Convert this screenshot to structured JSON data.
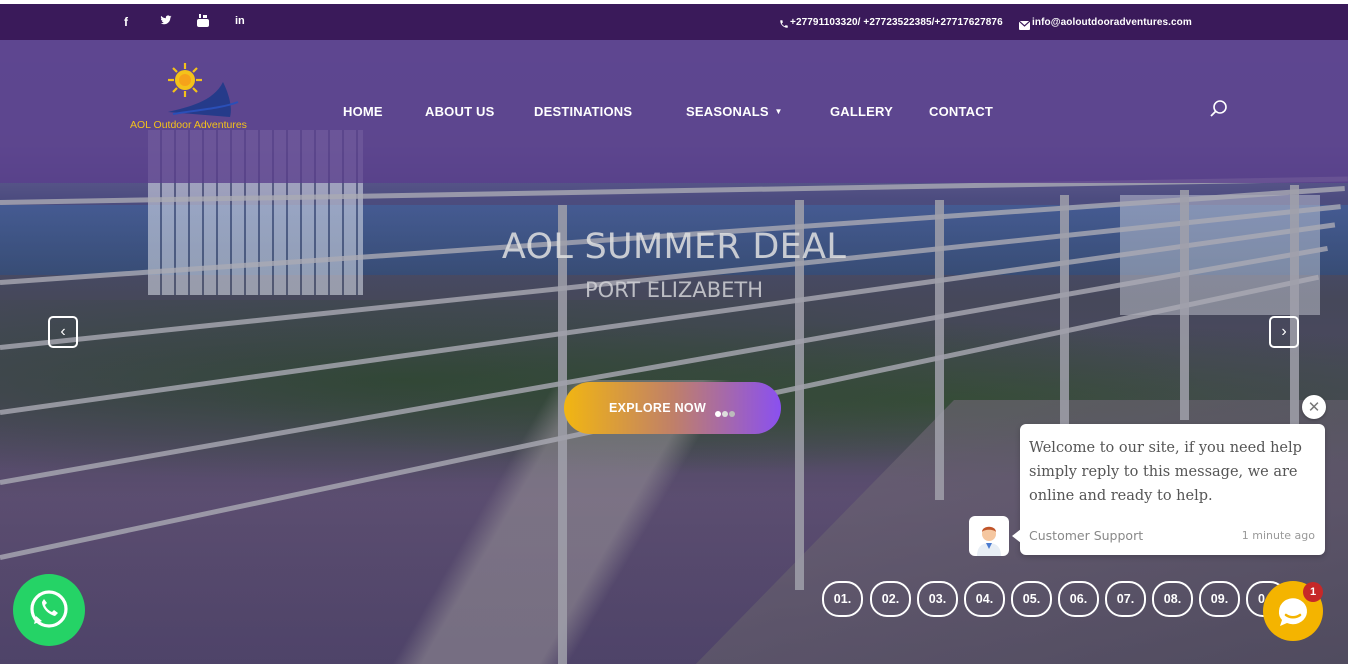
{
  "topbar": {
    "social": [
      {
        "icon": "facebook-icon",
        "glyph": "f"
      },
      {
        "icon": "twitter-icon",
        "glyph": "🐦"
      },
      {
        "icon": "youtube-icon",
        "glyph": "▶"
      },
      {
        "icon": "linkedin-icon",
        "glyph": "in"
      }
    ],
    "phone_icon": "phone-icon",
    "phone": "+27791103320/ +27723522385/+27717627876",
    "email_icon": "envelope-icon",
    "email": "info@aoloutdooradventures.com",
    "bg_color": "#3a1a5a"
  },
  "header": {
    "logo_text": "AOL Outdoor Adventures",
    "nav": [
      {
        "label": "HOME"
      },
      {
        "label": "ABOUT US"
      },
      {
        "label": "DESTINATIONS"
      },
      {
        "label": "SEASONALS",
        "dropdown": true
      },
      {
        "label": "GALLERY"
      },
      {
        "label": "CONTACT"
      }
    ],
    "search_icon": "search-icon",
    "logo_color": "#f4c21a"
  },
  "hero": {
    "title": "AOL SUMMER DEAL",
    "subtitle": "PORT ELIZABETH",
    "cta_label": "EXPLORE NOW",
    "cta_gradient": [
      "#f2b611",
      "#8a50f0"
    ],
    "prev_icon": "chevron-left-icon",
    "next_icon": "chevron-right-icon",
    "slides": [
      "01.",
      "02.",
      "03.",
      "04.",
      "05.",
      "06.",
      "07.",
      "08.",
      "09.",
      "0"
    ]
  },
  "chat": {
    "message": "Welcome to our site, if you need help simply reply to this message, we are online and ready to help.",
    "agent": "Customer Support",
    "time": "1 minute ago",
    "unread_count": "1",
    "launcher_color": "#f4b400",
    "close_icon": "close-icon"
  },
  "whatsapp": {
    "icon": "whatsapp-icon",
    "color": "#25d366"
  }
}
